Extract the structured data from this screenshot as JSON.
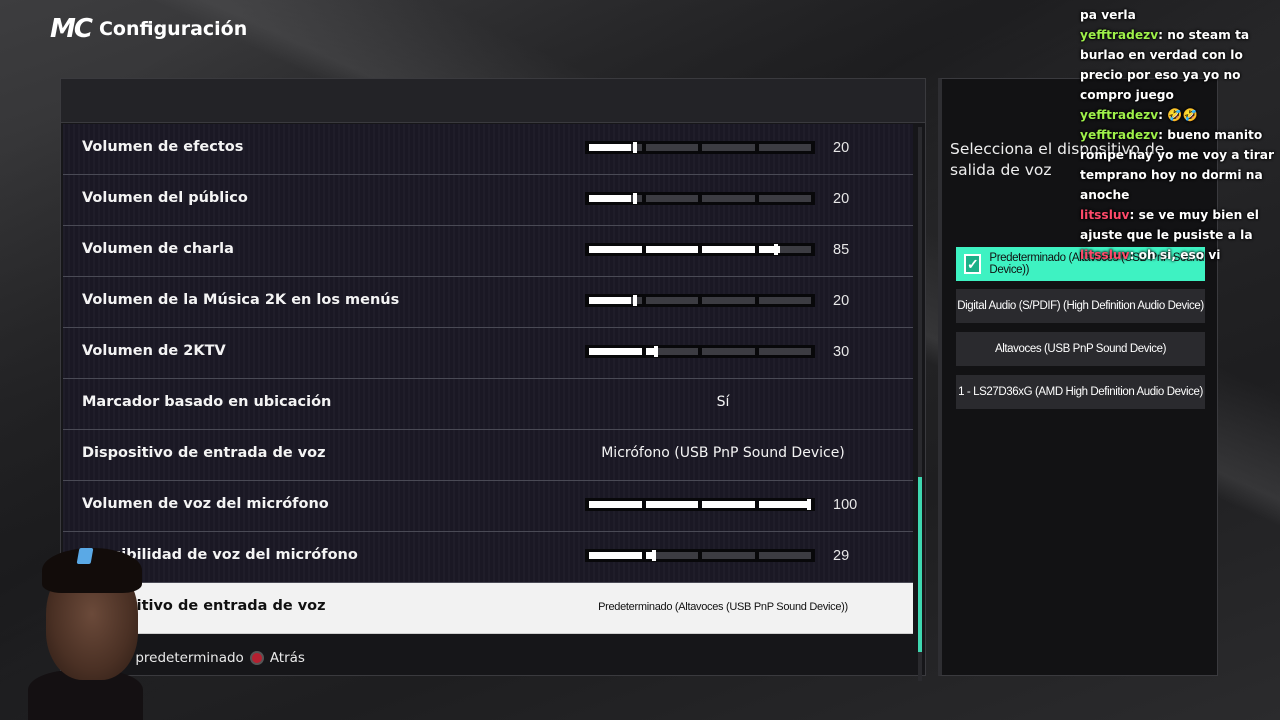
{
  "header": {
    "logo": "MC",
    "title": "Configuración"
  },
  "rows": [
    {
      "label": "Volumen de efectos",
      "type": "slider",
      "value": 20
    },
    {
      "label": "Volumen del público",
      "type": "slider",
      "value": 20
    },
    {
      "label": "Volumen de charla",
      "type": "slider",
      "value": 85
    },
    {
      "label": "Volumen de la Música 2K en los menús",
      "type": "slider",
      "value": 20
    },
    {
      "label": "Volumen de 2KTV",
      "type": "slider",
      "value": 30
    },
    {
      "label": "Marcador basado en ubicación",
      "type": "option",
      "value": "Sí"
    },
    {
      "label": "Dispositivo de entrada de voz",
      "type": "option",
      "value": "Micrófono (USB PnP Sound Device)"
    },
    {
      "label": "Volumen de voz del micrófono",
      "type": "slider",
      "value": 100
    },
    {
      "label": "Sensibilidad de voz del micrófono",
      "type": "slider",
      "value": 29
    },
    {
      "label": "Dispositivo de entrada de voz",
      "type": "option",
      "value": "Predeterminado (Altavoces (USB PnP Sound Device))",
      "selected": true
    }
  ],
  "footer": {
    "default_label": "Establecer predeterminado",
    "back_label": "Atrás"
  },
  "side": {
    "title": "Selecciona el dispositivo de salida de voz",
    "devices": [
      {
        "label": "Predeterminado (Altavoces (USB PnP Sound Device))",
        "active": true
      },
      {
        "label": "Digital Audio (S/PDIF) (High Definition Audio Device)",
        "active": false
      },
      {
        "label": "Altavoces (USB PnP Sound Device)",
        "active": false
      },
      {
        "label": "1 - LS27D36xG (AMD High Definition Audio Device)",
        "active": false
      }
    ]
  },
  "chat": [
    {
      "user": "",
      "text": "pa verla",
      "color": ""
    },
    {
      "user": "yefftradezv",
      "text": "no steam ta burlao en verdad con lo precio por eso ya yo no compro juego",
      "color": "green"
    },
    {
      "user": "yefftradezv",
      "text": "🤣🤣",
      "color": "green"
    },
    {
      "user": "yefftradezv",
      "text": "bueno manito rompe hay yo me voy a tirar temprano hoy no dormi na anoche",
      "color": "green"
    },
    {
      "user": "litssluv",
      "text": "se ve muy bien el ajuste que le pusiste a la",
      "color": "red"
    },
    {
      "user": "litssluv",
      "text": "oh si, eso vi",
      "color": "red"
    }
  ],
  "colors": {
    "accent": "#3ef2c2",
    "scroll": "#3fd7b0",
    "back_button": "#b52030"
  }
}
